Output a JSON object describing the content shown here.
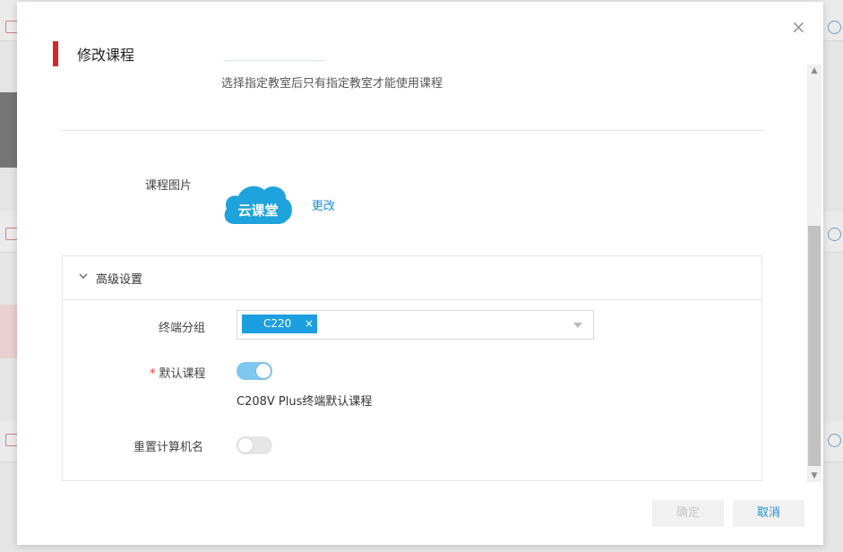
{
  "dialog": {
    "title": "修改课程",
    "close_icon": "close-icon"
  },
  "classroom": {
    "hint": "选择指定教室后只有指定教室才能使用课程"
  },
  "course_image": {
    "label": "课程图片",
    "logo_text": "云课堂",
    "logo_color": "#1ea3dc",
    "change_label": "更改"
  },
  "advanced": {
    "title": "高级设置",
    "terminal_group": {
      "label": "终端分组",
      "tags": [
        "C220"
      ],
      "tag_color": "#1c9fe0"
    },
    "default_course": {
      "label": "默认课程",
      "required": true,
      "enabled": true,
      "description": "C208V Plus终端默认课程"
    },
    "reset_computer_name": {
      "label": "重置计算机名",
      "enabled": false
    }
  },
  "footer": {
    "ok_label": "确定",
    "cancel_label": "取消"
  },
  "colors": {
    "accent": "#d9242b",
    "link": "#1c8fd6",
    "switch_on": "#7ec8ef"
  }
}
